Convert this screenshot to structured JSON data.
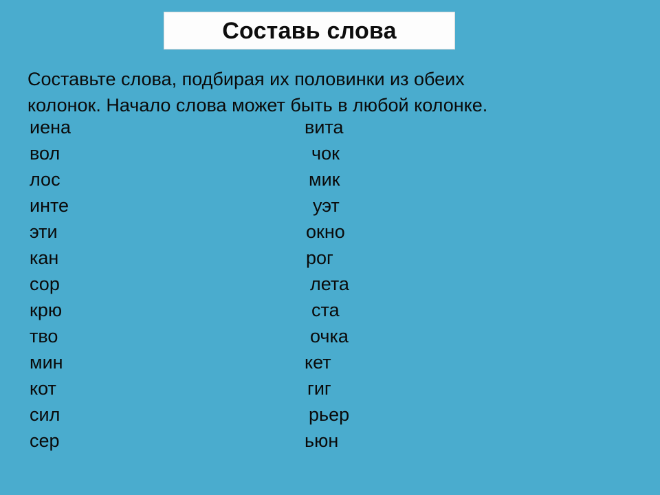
{
  "slide": {
    "background_color": "#4aacce",
    "text_color": "#0a0a0a",
    "title_box_color": "#fdfdfd",
    "title": "Составь слова",
    "instructions": [
      "Составьте слова, подбирая их половинки из обеих",
      "колонок. Начало слова может быть в любой колонке."
    ],
    "columns": {
      "left_header": "",
      "right_header": ""
    },
    "rows": [
      {
        "left": "иена",
        "right": "вита",
        "right_indent": 0
      },
      {
        "left": "вол",
        "right": "чок",
        "right_indent": 10
      },
      {
        "left": "лос",
        "right": "мик",
        "right_indent": 6
      },
      {
        "left": "инте",
        "right": "уэт",
        "right_indent": 12
      },
      {
        "left": "эти",
        "right": "окно",
        "right_indent": 2
      },
      {
        "left": "кан",
        "right": "рог",
        "right_indent": 2
      },
      {
        "left": "сор",
        "right": "лета",
        "right_indent": 8
      },
      {
        "left": "крю",
        "right": "ста",
        "right_indent": 10
      },
      {
        "left": "тво",
        "right": "очка",
        "right_indent": 8
      },
      {
        "left": "мин",
        "right": "кет",
        "right_indent": 0
      },
      {
        "left": "кот",
        "right": "гиг",
        "right_indent": 4
      },
      {
        "left": "сил",
        "right": "рьер",
        "right_indent": 6
      },
      {
        "left": "сер",
        "right": "ьюн",
        "right_indent": 0
      }
    ]
  }
}
